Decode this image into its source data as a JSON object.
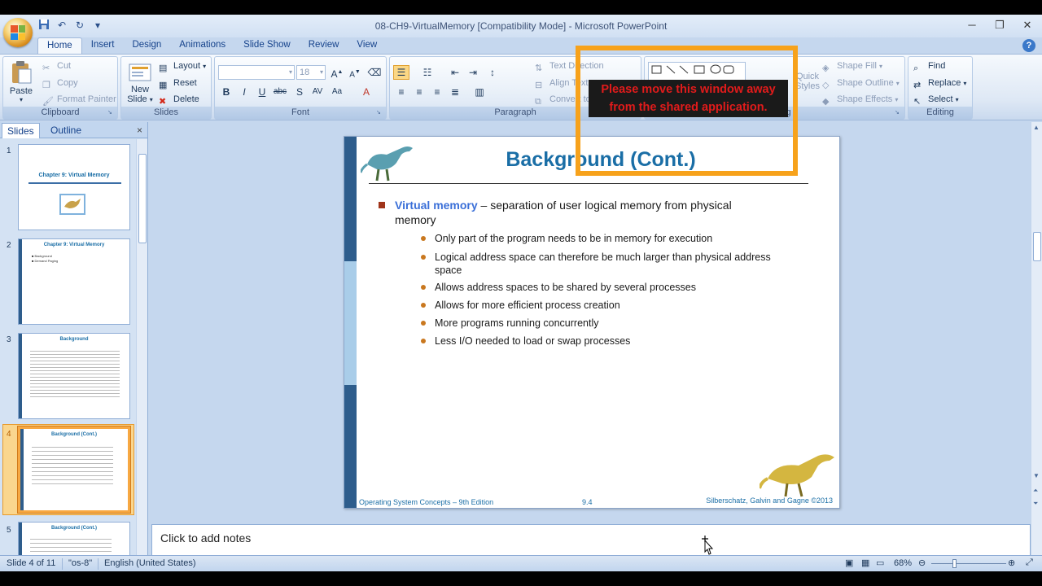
{
  "window": {
    "title": "08-CH9-VirtualMemory [Compatibility Mode] - Microsoft PowerPoint",
    "minimize": "─",
    "maximize": "❐",
    "close": "✕"
  },
  "ribbon_tabs": [
    "Home",
    "Insert",
    "Design",
    "Animations",
    "Slide Show",
    "Review",
    "View"
  ],
  "clipboard": {
    "paste": "Paste",
    "cut": "Cut",
    "copy": "Copy",
    "format_painter": "Format Painter",
    "label": "Clipboard"
  },
  "slides_group": {
    "new_slide_line1": "New",
    "new_slide_line2": "Slide",
    "layout": "Layout",
    "reset": "Reset",
    "delete": "Delete",
    "label": "Slides"
  },
  "font_group": {
    "font_size": "18",
    "label": "Font"
  },
  "paragraph_group": {
    "text_direction": "Text Direction",
    "align_text": "Align Text",
    "convert": "Convert to SmartArt",
    "label": "Paragraph"
  },
  "drawing_group": {
    "quick_styles_line1": "Quick",
    "quick_styles_line2": "Styles",
    "shape_fill": "Shape Fill",
    "shape_outline": "Shape Outline",
    "shape_effects": "Shape Effects",
    "label": "Drawing"
  },
  "editing_group": {
    "find": "Find",
    "replace": "Replace",
    "select": "Select",
    "label": "Editing"
  },
  "left_pane": {
    "tab_slides": "Slides",
    "tab_outline": "Outline",
    "close": "×",
    "thumbnails": [
      {
        "num": "1",
        "title": "Chapter 9: Virtual Memory"
      },
      {
        "num": "2",
        "title": "Chapter 9: Virtual Memory",
        "lines": [
          "■ Background",
          "■ Demand Paging"
        ]
      },
      {
        "num": "3",
        "title": "Background"
      },
      {
        "num": "4",
        "title": "Background (Cont.)"
      },
      {
        "num": "5",
        "title": "Background (Cont.)"
      }
    ]
  },
  "slide": {
    "title": "Background (Cont.)",
    "main_bullet_highlight": "Virtual memory",
    "main_bullet_text": " – separation of user logical memory  from physical memory",
    "sub_bullets": [
      "Only part of the program  needs to be in memory  for execution",
      "Logical address space  can therefore be much larger than physical address space",
      "Allows address spaces  to be shared by several  processes",
      "Allows  for more  efficient process creation",
      "More programs  running concurrently",
      "Less I/O needed to load  or swap  processes"
    ],
    "footer_left": "Operating System Concepts – 9th Edition",
    "footer_mid": "9.4",
    "footer_right": "Silberschatz, Galvin and Gagne ©2013"
  },
  "notes": {
    "placeholder": "Click to add notes"
  },
  "status": {
    "slide_info": "Slide 4 of 11",
    "theme": "\"os-8\"",
    "language": "English (United States)",
    "zoom": "68%"
  },
  "overlay": {
    "message": "Please move this window away from the shared application."
  },
  "colors": {
    "accent_blue": "#1a6ea6",
    "share_frame": "#f7a21b",
    "share_text": "#e11b1b"
  }
}
